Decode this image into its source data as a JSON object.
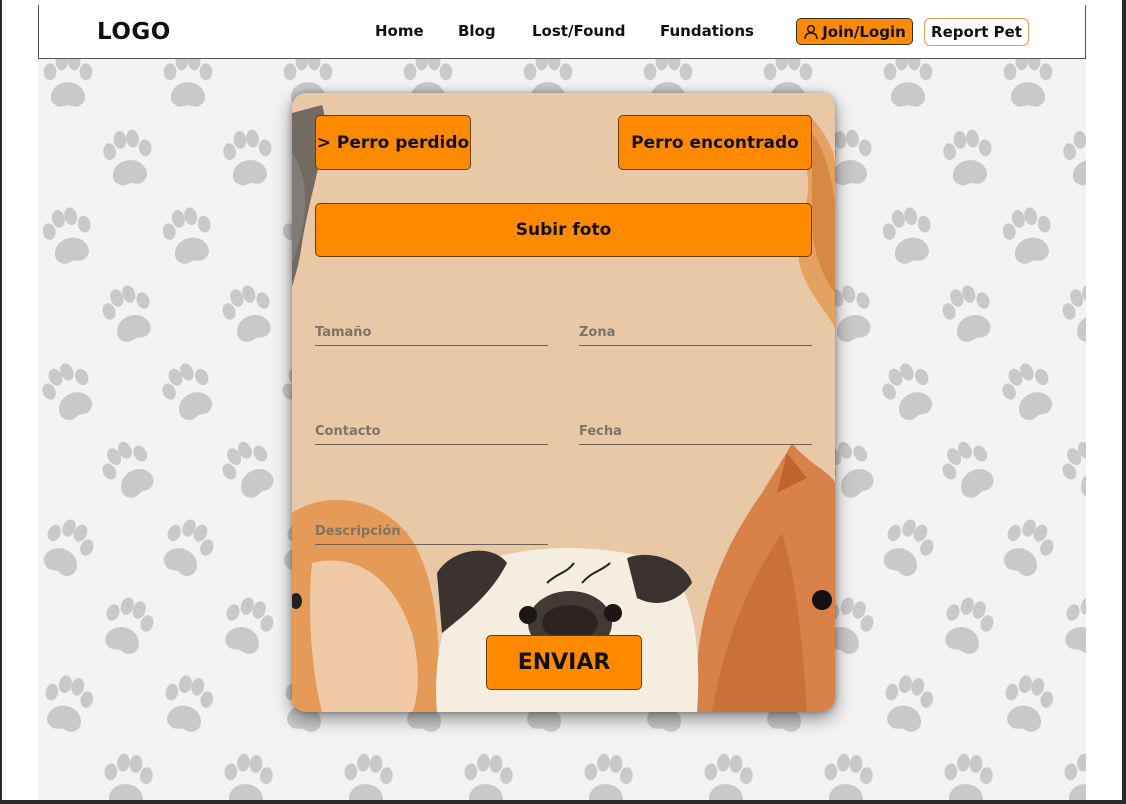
{
  "nav": {
    "logo": "LOGO",
    "links": [
      "Home",
      "Blog",
      "Lost/Found",
      "Fundations"
    ],
    "join_label": "Join/Login",
    "report_label": "Report Pet"
  },
  "form": {
    "lost_label": "> Perro perdido",
    "found_label": "Perro encontrado",
    "upload_label": "Subir foto",
    "fields": {
      "size": "Tamaño",
      "zone": "Zona",
      "contact": "Contacto",
      "date": "Fecha",
      "description": "Descripción"
    },
    "submit_label": "ENVIAR"
  },
  "colors": {
    "accent": "#ff8a00",
    "card_bg": "#e9c8a6",
    "paw": "#c9c9c9"
  },
  "icons": {
    "join": "user-icon",
    "pattern": "paw-print-icon"
  }
}
